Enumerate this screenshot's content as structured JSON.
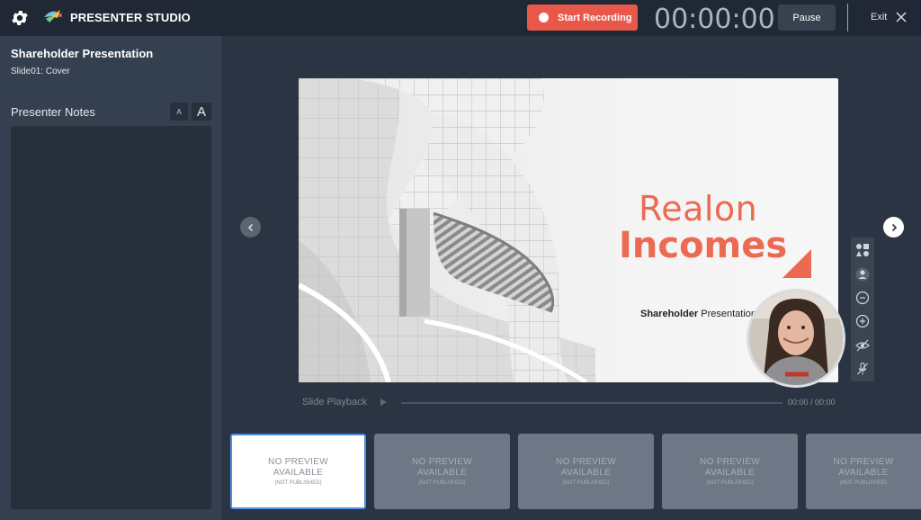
{
  "app": {
    "title": "PRESENTER STUDIO"
  },
  "toolbar": {
    "record_label": "Start Recording",
    "timer": "00:00:00",
    "pause_label": "Pause",
    "exit_label": "Exit"
  },
  "sidebar": {
    "presentation_title": "Shareholder Presentation",
    "slide_subtitle": "Slide01: Cover",
    "notes_label": "Presenter Notes",
    "font_small": "A",
    "font_large": "A",
    "notes_text": ""
  },
  "slide": {
    "title_line1": "Realon",
    "title_line2": "Incomes",
    "subtitle_bold": "Shareholder",
    "subtitle_rest": " Presentation",
    "accent_color": "#ec6a52"
  },
  "playback": {
    "label": "Slide Playback",
    "time": "00:00 / 00:00"
  },
  "thumbnails": [
    {
      "line1": "NO PREVIEW",
      "line2": "AVAILABLE",
      "note": "(NOT PUBLISHED)",
      "active": true
    },
    {
      "line1": "NO PREVIEW",
      "line2": "AVAILABLE",
      "note": "(NOT PUBLISHED)",
      "active": false
    },
    {
      "line1": "NO PREVIEW",
      "line2": "AVAILABLE",
      "note": "(NOT PUBLISHED)",
      "active": false
    },
    {
      "line1": "NO PREVIEW",
      "line2": "AVAILABLE",
      "note": "(NOT PUBLISHED)",
      "active": false
    },
    {
      "line1": "NO PREVIEW",
      "line2": "AVAILABLE",
      "note": "(NOT PUBLISHED)",
      "active": false
    }
  ],
  "tools": [
    "shapes-icon",
    "person-icon",
    "zoom-out-icon",
    "zoom-in-icon",
    "hide-icon",
    "mic-off-icon"
  ],
  "colors": {
    "record": "#e8584a",
    "topbar": "#1f2834",
    "sidebar": "#34404f",
    "stage": "#2a3442"
  }
}
